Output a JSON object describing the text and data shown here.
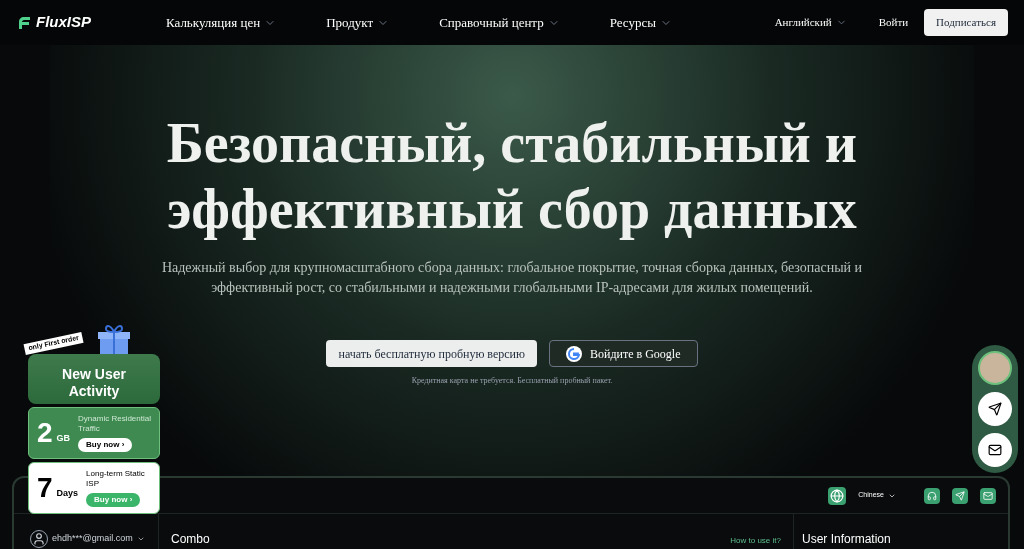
{
  "nav": {
    "logo": "FluxISP",
    "items": [
      "Калькуляция цен",
      "Продукт",
      "Справочный центр",
      "Ресурсы"
    ],
    "language": "Английский",
    "login": "Войти",
    "signup": "Подписаться"
  },
  "hero": {
    "title": "Безопасный, стабильный и эффективный сбор данных",
    "subtitle": "Надежный выбор для крупномасштабного сбора данных: глобальное покрытие, точная сборка данных, безопасный и эффективный рост, со стабильными и надежными глобальными IP-адресами для жилых помещений.",
    "primary_button": "начать бесплатную пробную версию",
    "google_button": "Войдите в Google",
    "note": "Кредитная карта не требуется. Бесплатный пробный пакет."
  },
  "promo": {
    "tag": "only First order",
    "title": "New User Activity",
    "offers": [
      {
        "kind": "green",
        "amount": "2",
        "unit": "GB",
        "description": "Dynamic Residential Traffic",
        "button": "Buy now ›"
      },
      {
        "kind": "white",
        "amount": "7",
        "unit": "Days",
        "description": "Long-term Static ISP",
        "button": "Buy now ›"
      }
    ]
  },
  "dashboard": {
    "language": "Chinese",
    "user": "ehdh***@gmail.com",
    "section": "Combo",
    "help_link": "How to use it?",
    "side_title": "User Information"
  }
}
